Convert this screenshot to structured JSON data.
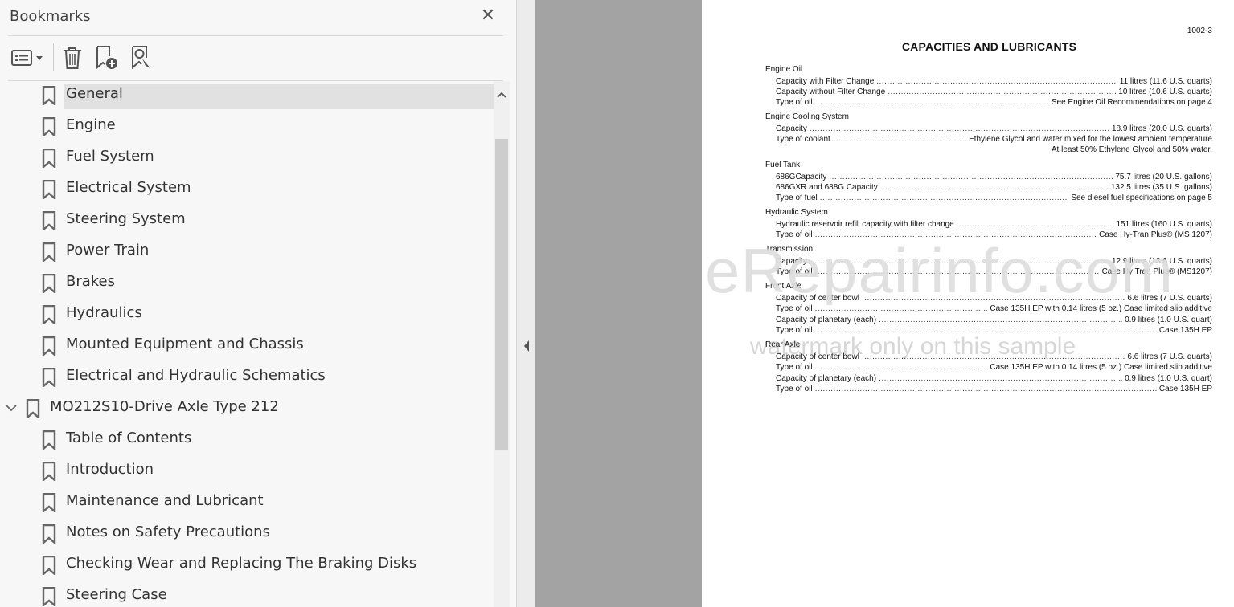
{
  "panel": {
    "title": "Bookmarks",
    "close_glyph": "✕"
  },
  "toolbar": {
    "options_icon": "list-options-icon",
    "delete_icon": "trash-icon",
    "new_bookmark_icon": "add-bookmark-icon",
    "find_bookmark_icon": "find-current-bookmark-icon"
  },
  "bookmarks": [
    {
      "label": "General",
      "selected": true
    },
    {
      "label": "Engine"
    },
    {
      "label": "Fuel System"
    },
    {
      "label": "Electrical System"
    },
    {
      "label": "Steering System"
    },
    {
      "label": "Power Train"
    },
    {
      "label": "Brakes"
    },
    {
      "label": "Hydraulics"
    },
    {
      "label": "Mounted Equipment and Chassis"
    },
    {
      "label": "Electrical and Hydraulic Schematics"
    },
    {
      "label": "MO212S10-Drive Axle Type 212",
      "expanded": true
    },
    {
      "label": "Table of Contents"
    },
    {
      "label": "Introduction"
    },
    {
      "label": "Maintenance and Lubricant"
    },
    {
      "label": "Notes on Safety Precautions"
    },
    {
      "label": "Checking Wear and Replacing The Braking Disks"
    },
    {
      "label": "Steering Case"
    }
  ],
  "document": {
    "page_number": "1002-3",
    "title": "CAPACITIES AND LUBRICANTS",
    "sections": [
      {
        "heading": "Engine Oil",
        "rows": [
          {
            "label": "Capacity with Filter Change",
            "value": "11 litres (11.6 U.S. quarts)"
          },
          {
            "label": "Capacity without Filter Change",
            "value": "10 litres (10.6 U.S. quarts)"
          },
          {
            "label": "Type of oil",
            "value": "See Engine Oil Recommendations on page 4"
          }
        ]
      },
      {
        "heading": "Engine Cooling System",
        "rows": [
          {
            "label": "Capacity",
            "value": "18.9 litres (20.0 U.S. quarts)"
          },
          {
            "label": "Type of coolant",
            "value": "Ethylene Glycol and water mixed for the lowest ambient temperature"
          },
          {
            "label": "",
            "value": "At least 50% Ethylene Glycol and 50% water."
          }
        ]
      },
      {
        "heading": "Fuel Tank",
        "rows": [
          {
            "label": "686GCapacity",
            "value": "75.7 litres (20 U.S. gallons)"
          },
          {
            "label": "686GXR and 688G Capacity",
            "value": "132.5 litres (35 U.S. gallons)"
          },
          {
            "label": "Type of fuel",
            "value": "See diesel fuel specifications on page 5"
          }
        ]
      },
      {
        "heading": "Hydraulic System",
        "rows": [
          {
            "label": "Hydraulic reservoir refill capacity with filter change",
            "value": "151 litres (160 U.S. quarts)"
          },
          {
            "label": "Type of oil",
            "value": "Case Hy-Tran Plus® (MS 1207)"
          }
        ]
      },
      {
        "heading": "Transmission",
        "rows": [
          {
            "label": "Capacity",
            "value": "12.9 litres (13.6 U.S. quarts)"
          },
          {
            "label": "Type of oil",
            "value": "Case Hy Tran Plus® (MS1207)"
          }
        ]
      },
      {
        "heading": "Front Axle",
        "rows": [
          {
            "label": "Capacity of center bowl",
            "value": "6.6 litres (7 U.S. quarts)"
          },
          {
            "label": "Type of oil",
            "value": "Case 135H EP with 0.14 litres (5 oz.) Case limited slip additive"
          },
          {
            "label": "Capacity of planetary (each)",
            "value": "0.9 litres (1.0 U.S. quart)"
          },
          {
            "label": "Type of oil",
            "value": "Case 135H EP"
          }
        ]
      },
      {
        "heading": "Rear Axle",
        "rows": [
          {
            "label": "Capacity of center bowl",
            "value": "6.6 litres (7 U.S. quarts)"
          },
          {
            "label": "Type of oil",
            "value": "Case 135H EP with 0.14 litres (5 oz.) Case limited slip additive"
          },
          {
            "label": "Capacity of planetary (each)",
            "value": "0.9 litres (1.0 U.S. quart)"
          },
          {
            "label": "Type of oil",
            "value": "Case 135H EP"
          }
        ]
      }
    ],
    "watermark_main": "eRepairinfo.com",
    "watermark_sub": "watermark only on this sample"
  }
}
